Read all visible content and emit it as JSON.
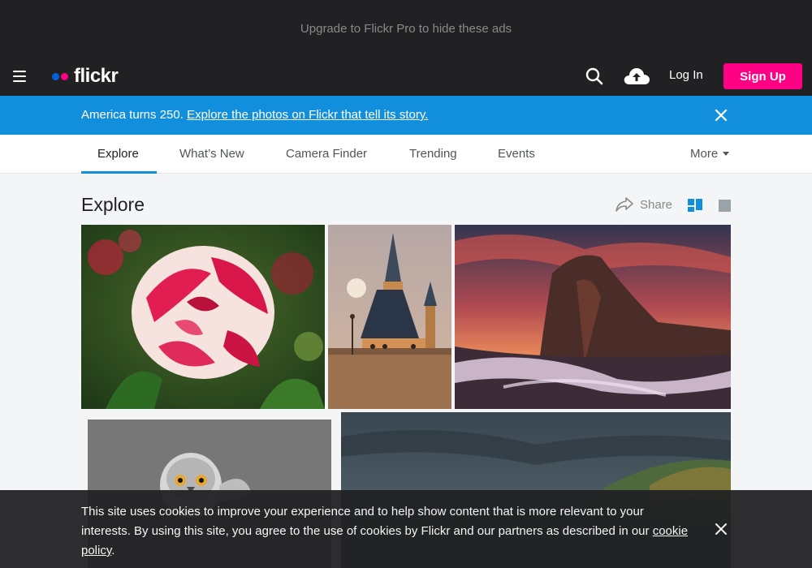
{
  "ad": {
    "text": "Upgrade to Flickr Pro to hide these ads"
  },
  "nav": {
    "logo_text": "flickr",
    "login": "Log In",
    "signup": "Sign Up",
    "brand_colors": {
      "blue": "#0063dc",
      "pink": "#ff0084"
    }
  },
  "announcement": {
    "prefix": "America turns 250.",
    "link": "Explore the photos on Flickr that tell its story."
  },
  "subnav": {
    "tabs": [
      "Explore",
      "What’s New",
      "Camera Finder",
      "Trending",
      "Events"
    ],
    "more": "More"
  },
  "main": {
    "title": "Explore",
    "share": "Share"
  },
  "photos": [
    {
      "subject": "red-and-white-rose"
    },
    {
      "subject": "castle-tower-with-moon"
    },
    {
      "subject": "sunset-coastal-rock"
    },
    {
      "subject": "owl-black-and-white"
    },
    {
      "subject": "stormy-hills-landscape"
    }
  ],
  "cookie": {
    "text": "This site uses cookies to improve your experience and to help show content that is more relevant to your interests. By using this site, you agree to the use of cookies by Flickr and our partners as described in our ",
    "link": "cookie policy",
    "suffix": "."
  },
  "colors": {
    "accent": "#128fdc",
    "signup": "#ff0084",
    "dark": "#212124"
  }
}
